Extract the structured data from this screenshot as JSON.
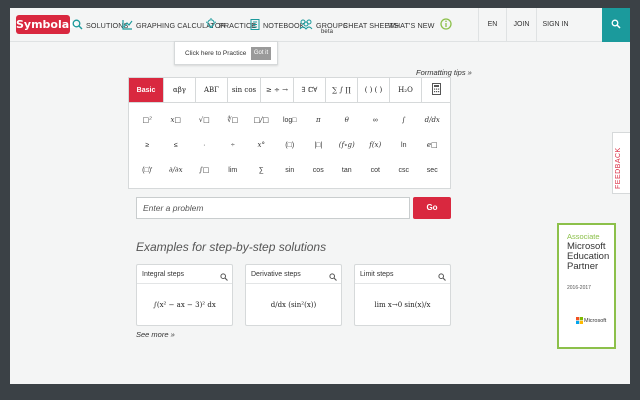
{
  "nav": {
    "logo": "Symbolab",
    "items": [
      {
        "label": "SOLUTIONS",
        "icon": "search-icon"
      },
      {
        "label": "GRAPHING CALCULATOR",
        "icon": "graph-icon"
      },
      {
        "label": "PRACTICE",
        "icon": "lightbulb-icon"
      },
      {
        "label": "NOTEBOOK",
        "icon": "notebook-icon"
      },
      {
        "label": "GROUPS",
        "sub": "beta",
        "icon": "groups-icon"
      },
      {
        "label": "CHEAT SHEETS"
      },
      {
        "label": "WHAT'S NEW",
        "icon": "info-icon"
      }
    ],
    "lang": "EN",
    "join": "JOIN",
    "signin": "SIGN IN"
  },
  "tooltip": {
    "text": "Click here to Practice",
    "button": "Got it"
  },
  "formatting_tips": "Formatting tips »",
  "keyboard": {
    "tabs": [
      "Basic",
      "αβγ",
      "ABΓ",
      "sin cos",
      "≥ ÷ →",
      "∃ ℂ∀",
      "∑ ∫ ∏",
      "( ) ( )",
      "H₂O",
      "▦"
    ],
    "rows": [
      [
        "□²",
        "x□",
        "√□",
        "∜□",
        "□/□",
        "log□",
        "π",
        "θ",
        "∞",
        "∫",
        "d/dx"
      ],
      [
        "≥",
        "≤",
        "·",
        "÷",
        "x°",
        "(□)",
        "|□|",
        "(f∘g)",
        "f(x)",
        "ln",
        "e□"
      ],
      [
        "(□)′",
        "∂/∂x",
        "∫□",
        "lim",
        "∑",
        "sin",
        "cos",
        "tan",
        "cot",
        "csc",
        "sec"
      ]
    ]
  },
  "input": {
    "placeholder": "Enter a problem",
    "go": "Go"
  },
  "examples": {
    "title": "Examples for step-by-step solutions",
    "cards": [
      {
        "title": "Integral steps",
        "math": "∫(x² − ax − 3)² dx"
      },
      {
        "title": "Derivative steps",
        "math": "d/dx (sin²(x))"
      },
      {
        "title": "Limit steps",
        "math": "lim x→0 sin(x)/x"
      }
    ],
    "see_more": "See more »"
  },
  "feedback": "FEEDBACK",
  "badge": {
    "line1": "Associate",
    "line2": "Microsoft",
    "line3": "Education",
    "line4": "Partner",
    "years": "2016-2017",
    "brand": "Microsoft"
  },
  "colors": {
    "accent": "#d9283f",
    "teal": "#1b9a9c",
    "badge_green": "#8cc04a"
  }
}
